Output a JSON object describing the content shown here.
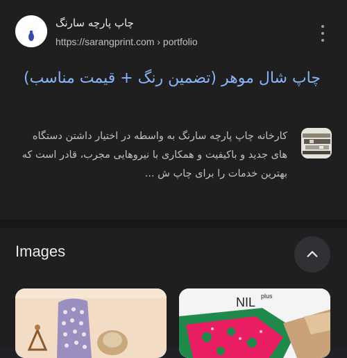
{
  "result": {
    "site_name": "چاپ پارچه سارنگ",
    "url": "https://sarangprint.com › portfolio",
    "title": "چاپ شال موهر (تضمین رنگ + قیمت مناسب)",
    "snippet": "کارخانه چاپ پارچه سارنگ به واسطه در اختیار داشتن دستگاه های جدید و باکیفیت و همکاری با نیروهایی مجرب، قادر است که بهترین خدمات را برای چاپ ش ...",
    "favicon_icon": "peacock-logo-icon",
    "menu_icon": "more-vert-icon",
    "thumbnail_icon": "fabric-thumbnail"
  },
  "images": {
    "heading": "Images",
    "collapse_icon": "chevron-up-icon",
    "cards": [
      {
        "name": "scarf-product-image"
      },
      {
        "name": "nil-plus-fabric-image",
        "logo_text": "NIL",
        "logo_sup": "plus"
      }
    ]
  },
  "colors": {
    "background": "#1f1f1f",
    "link": "#8ab4f8",
    "text": "#e8eaed",
    "muted": "#bdc1c6"
  }
}
